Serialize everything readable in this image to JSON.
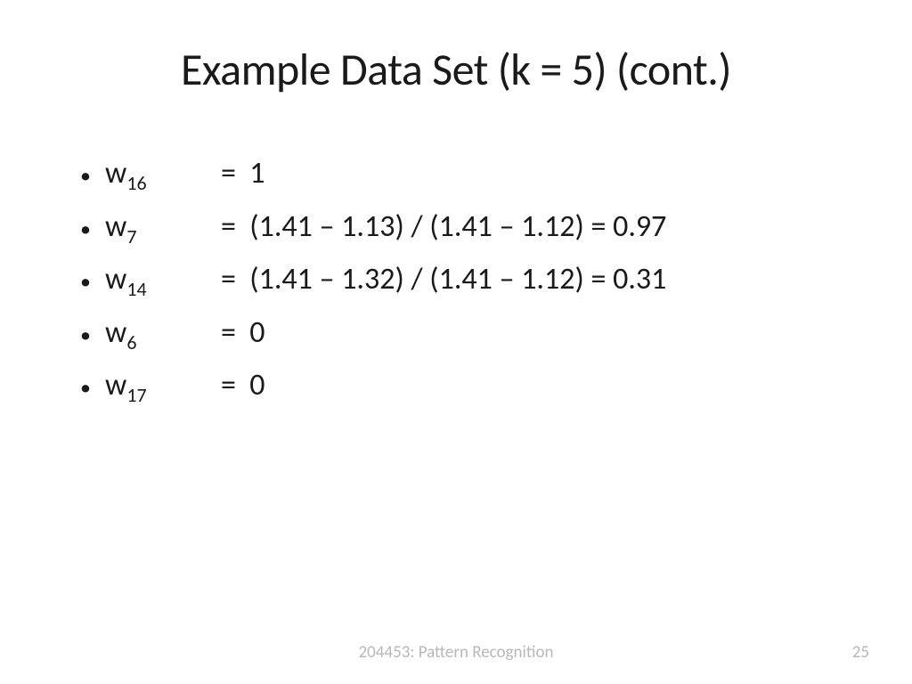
{
  "title": "Example Data Set (k = 5) (cont.)",
  "rows": [
    {
      "bullet": "•",
      "var_base": "w",
      "var_sub": "16",
      "eq": "=  1"
    },
    {
      "bullet": "•",
      "var_base": "w",
      "var_sub": "7",
      "eq": "=  (1.41 – 1.13) / (1.41 – 1.12) = 0.97"
    },
    {
      "bullet": "•",
      "var_base": "w",
      "var_sub": "14",
      "eq": "=  (1.41 – 1.32) / (1.41 – 1.12) = 0.31"
    },
    {
      "bullet": "•",
      "var_base": "w",
      "var_sub": "6",
      "eq": "=  0"
    },
    {
      "bullet": "•",
      "var_base": "w",
      "var_sub": "17",
      "eq": "=  0"
    }
  ],
  "footer": "204453: Pattern Recognition",
  "page": "25"
}
